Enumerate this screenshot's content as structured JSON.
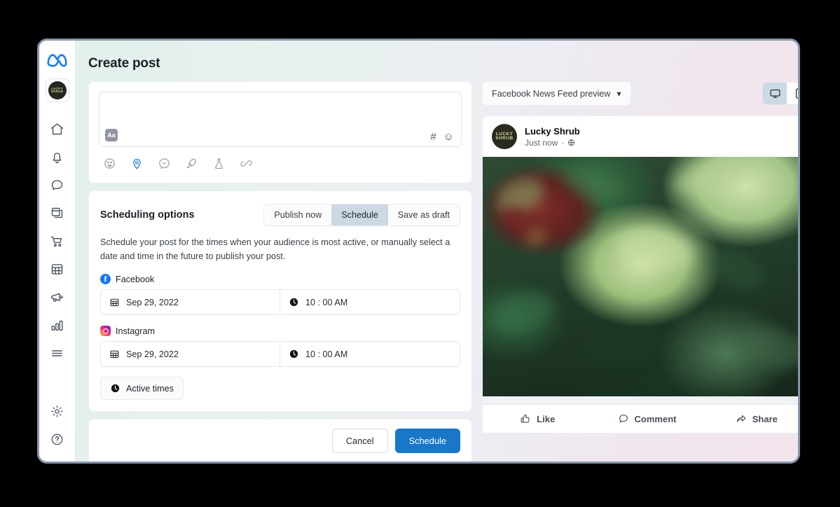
{
  "header": {
    "title": "Create post"
  },
  "sidebar": {
    "logo": "meta-logo",
    "brand": {
      "line1": "LUCKY",
      "line2": "SHRUB"
    },
    "items": [
      {
        "icon": "home-icon",
        "label": "Home"
      },
      {
        "icon": "bell-icon",
        "label": "Notifications"
      },
      {
        "icon": "chat-bubble-icon",
        "label": "Inbox"
      },
      {
        "icon": "posts-icon",
        "label": "Posts"
      },
      {
        "icon": "shopping-cart-icon",
        "label": "Commerce"
      },
      {
        "icon": "grid-table-icon",
        "label": "Planner"
      },
      {
        "icon": "megaphone-icon",
        "label": "Ads"
      },
      {
        "icon": "bar-chart-icon",
        "label": "Insights"
      },
      {
        "icon": "hamburger-menu-icon",
        "label": "More"
      }
    ],
    "bottom_items": [
      {
        "icon": "gear-icon",
        "label": "Settings"
      },
      {
        "icon": "help-circle-icon",
        "label": "Help"
      }
    ]
  },
  "composer": {
    "text_value": "",
    "placeholder": "",
    "format_button": "Aa",
    "hashtag_glyph": "#",
    "emoji_glyph": "☺",
    "tools": [
      {
        "icon": "emoji-feeling-icon",
        "label": "Feeling/activity",
        "active": false
      },
      {
        "icon": "location-pin-icon",
        "label": "Check in",
        "active": true
      },
      {
        "icon": "messenger-icon",
        "label": "Messenger",
        "active": false
      },
      {
        "icon": "rocket-icon",
        "label": "Boost",
        "active": false
      },
      {
        "icon": "flask-icon",
        "label": "Experiment",
        "active": false
      },
      {
        "icon": "link-icon",
        "label": "Link",
        "active": false
      }
    ]
  },
  "scheduling": {
    "title": "Scheduling options",
    "tabs": [
      {
        "label": "Publish now",
        "selected": false
      },
      {
        "label": "Schedule",
        "selected": true
      },
      {
        "label": "Save as draft",
        "selected": false
      }
    ],
    "description": "Schedule your post for the times when your audience is most active, or manually select a date and time in the future to publish your post.",
    "networks": [
      {
        "name": "Facebook",
        "icon": "facebook-icon",
        "date": "Sep 29, 2022",
        "time": "10 : 00 AM",
        "date_icon": "calendar-icon",
        "time_icon": "clock-icon"
      },
      {
        "name": "Instagram",
        "icon": "instagram-icon",
        "date": "Sep 29, 2022",
        "time": "10 : 00 AM",
        "date_icon": "calendar-icon",
        "time_icon": "clock-icon"
      }
    ],
    "active_times_button": {
      "label": "Active times",
      "icon": "clock-icon"
    }
  },
  "footer": {
    "cancel_label": "Cancel",
    "schedule_label": "Schedule",
    "primary_color": "#1877c9"
  },
  "preview": {
    "select_label": "Facebook News Feed preview",
    "chevron": "▾",
    "devices": [
      {
        "icon": "desktop-icon",
        "label": "Desktop",
        "selected": true
      },
      {
        "icon": "mobile-icon",
        "label": "Mobile",
        "selected": false
      }
    ],
    "post": {
      "author": "Lucky Shrub",
      "avatar_line1": "LUCKY",
      "avatar_line2": "SHRUB",
      "timestamp": "Just now",
      "separator": "·",
      "privacy_icon": "globe-icon",
      "image_alt": "succulent-plants-photo"
    },
    "actions": [
      {
        "label": "Like",
        "icon": "thumbs-up-icon"
      },
      {
        "label": "Comment",
        "icon": "comment-icon"
      },
      {
        "label": "Share",
        "icon": "share-arrow-icon"
      }
    ]
  }
}
